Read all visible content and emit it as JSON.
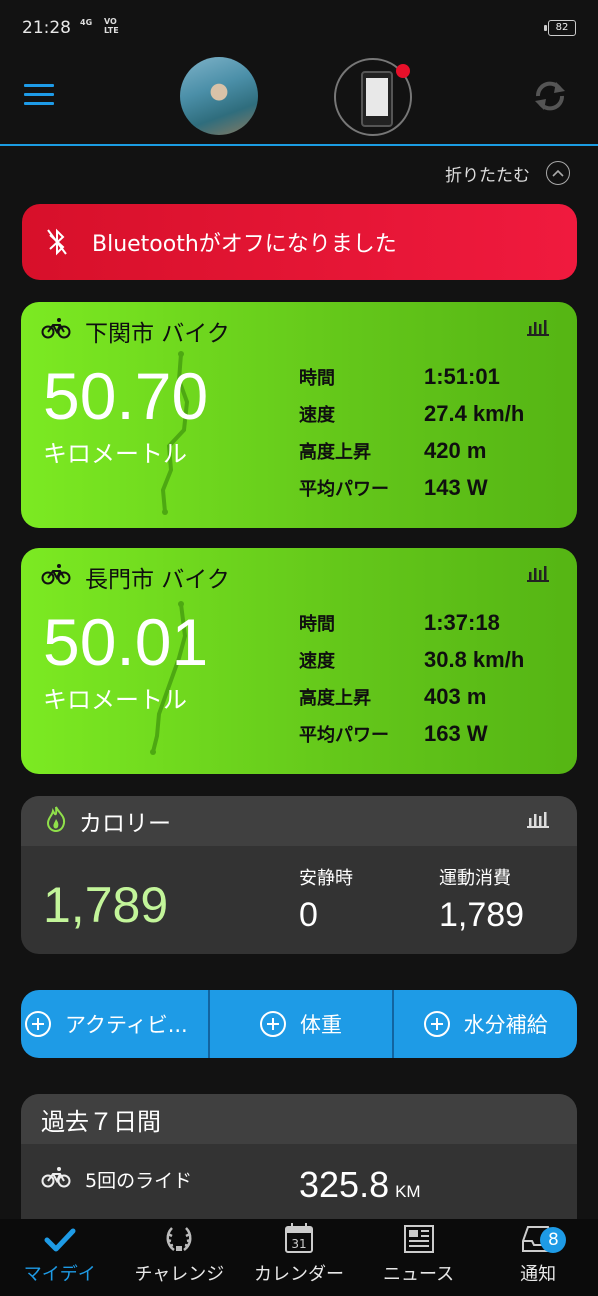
{
  "status_bar": {
    "time": "21:28",
    "signal": "4G",
    "volte_top": "VO",
    "volte_bottom": "LTE",
    "battery": "82"
  },
  "header": {
    "collapse_label": "折りたたむ"
  },
  "alert": {
    "text": "Bluetoothがオフになりました",
    "color": "#e8142f"
  },
  "activities": [
    {
      "title": "下関市 バイク",
      "distance": "50.70",
      "unit": "キロメートル",
      "stats": [
        {
          "label": "時間",
          "value": "1:51:01"
        },
        {
          "label": "速度",
          "value": "27.4 km/h"
        },
        {
          "label": "高度上昇",
          "value": "420 m"
        },
        {
          "label": "平均パワー",
          "value": "143 W"
        }
      ]
    },
    {
      "title": "長門市 バイク",
      "distance": "50.01",
      "unit": "キロメートル",
      "stats": [
        {
          "label": "時間",
          "value": "1:37:18"
        },
        {
          "label": "速度",
          "value": "30.8 km/h"
        },
        {
          "label": "高度上昇",
          "value": "403 m"
        },
        {
          "label": "平均パワー",
          "value": "163 W"
        }
      ]
    }
  ],
  "calories": {
    "title": "カロリー",
    "total": "1,789",
    "resting_label": "安静時",
    "resting_value": "0",
    "active_label": "運動消費",
    "active_value": "1,789"
  },
  "add_bar": [
    {
      "label": "アクティビ..."
    },
    {
      "label": "体重"
    },
    {
      "label": "水分補給"
    }
  ],
  "past7": {
    "title": "過去７日間",
    "rides_label": "5回のライド",
    "distance_value": "325.8",
    "distance_unit": "KM"
  },
  "nav": [
    {
      "label": "マイデイ",
      "icon": "check-icon",
      "active": true
    },
    {
      "label": "チャレンジ",
      "icon": "laurel-icon"
    },
    {
      "label": "カレンダー",
      "icon": "calendar-icon",
      "calendar_day": "31"
    },
    {
      "label": "ニュース",
      "icon": "newspaper-icon"
    },
    {
      "label": "通知",
      "icon": "inbox-icon",
      "badge": "8"
    }
  ],
  "colors": {
    "accent": "#1e9be6",
    "activity_green": "#6fd81e",
    "calorie_value": "#c3f59a"
  }
}
